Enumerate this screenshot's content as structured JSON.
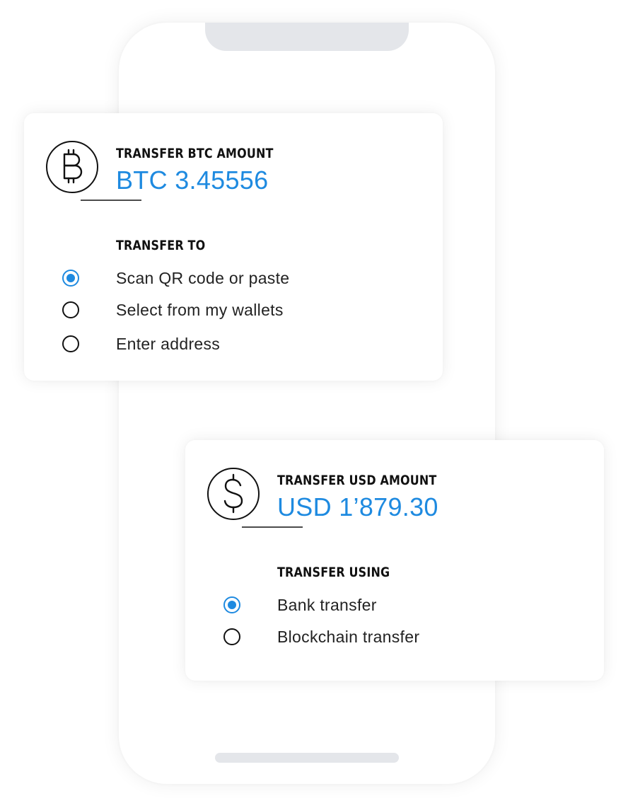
{
  "btc_card": {
    "icon": "bitcoin-icon",
    "amount_label": "TRANSFER BTC AMOUNT",
    "amount_value": "BTC 3.45556",
    "section_label": "TRANSFER TO",
    "options": [
      {
        "label": "Scan QR code or paste",
        "selected": true
      },
      {
        "label": "Select from my wallets",
        "selected": false
      },
      {
        "label": "Enter address",
        "selected": false
      }
    ]
  },
  "usd_card": {
    "icon": "dollar-icon",
    "amount_label": "TRANSFER USD AMOUNT",
    "amount_value": "USD 1’879.30",
    "section_label": "TRANSFER USING",
    "options": [
      {
        "label": "Bank transfer",
        "selected": true
      },
      {
        "label": "Blockchain transfer",
        "selected": false
      }
    ]
  },
  "colors": {
    "accent": "#1e8ae0",
    "text": "#111111",
    "phone_chrome": "#e4e6ea"
  }
}
